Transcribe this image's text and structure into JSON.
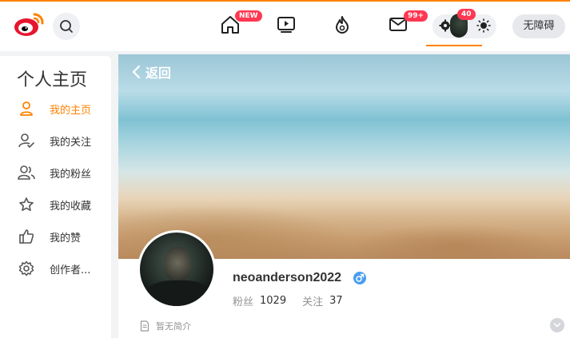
{
  "header": {
    "badges": {
      "home": "NEW",
      "messages": "99+",
      "settings": "40"
    },
    "accessibility_label": "无障碍",
    "icons": [
      "weibo-logo",
      "search-icon",
      "home-icon",
      "video-icon",
      "hot-icon",
      "mail-icon",
      "gear-icon",
      "sun-icon"
    ],
    "accent_color": "#ff8200",
    "badge_color": "#ff3852"
  },
  "sidebar": {
    "title": "个人主页",
    "items": [
      {
        "label": "我的主页",
        "icon": "person-icon",
        "active": true
      },
      {
        "label": "我的关注",
        "icon": "person-check-icon",
        "active": false
      },
      {
        "label": "我的粉丝",
        "icon": "people-icon",
        "active": false
      },
      {
        "label": "我的收藏",
        "icon": "star-icon",
        "active": false
      },
      {
        "label": "我的赞",
        "icon": "thumbs-up-icon",
        "active": false
      },
      {
        "label": "创作者...",
        "icon": "gear-icon",
        "active": false
      }
    ]
  },
  "profile": {
    "back_label": "返回",
    "username": "neoanderson2022",
    "gender": "male",
    "fans_label": "粉丝",
    "fans_count": "1029",
    "following_label": "关注",
    "following_count": "37",
    "bio": "暂无简介"
  }
}
